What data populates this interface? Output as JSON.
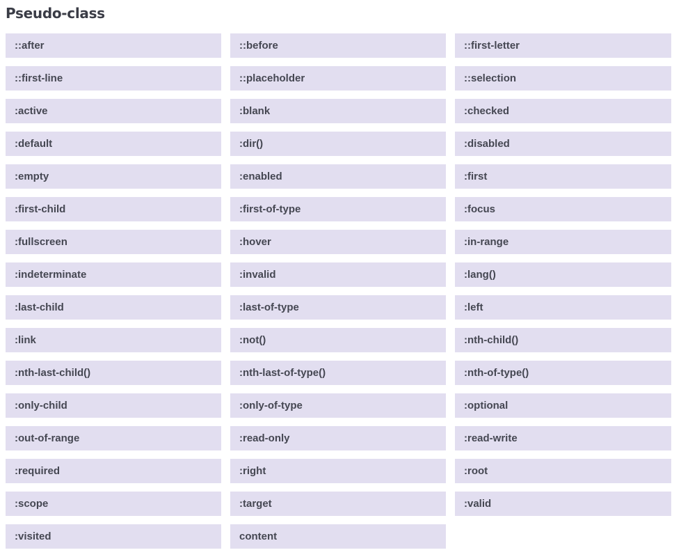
{
  "heading": "Pseudo-class",
  "items": [
    "::after",
    "::before",
    "::first-letter",
    "::first-line",
    "::placeholder",
    "::selection",
    ":active",
    ":blank",
    ":checked",
    ":default",
    ":dir()",
    ":disabled",
    ":empty",
    ":enabled",
    ":first",
    ":first-child",
    ":first-of-type",
    ":focus",
    ":fullscreen",
    ":hover",
    ":in-range",
    ":indeterminate",
    ":invalid",
    ":lang()",
    ":last-child",
    ":last-of-type",
    ":left",
    ":link",
    ":not()",
    ":nth-child()",
    ":nth-last-child()",
    ":nth-last-of-type()",
    ":nth-of-type()",
    ":only-child",
    ":only-of-type",
    ":optional",
    ":out-of-range",
    ":read-only",
    ":read-write",
    ":required",
    ":right",
    ":root",
    ":scope",
    ":target",
    ":valid",
    ":visited",
    "content"
  ],
  "colors": {
    "tile_background": "#e2def0",
    "text": "#454752",
    "heading": "#3a3c46"
  }
}
